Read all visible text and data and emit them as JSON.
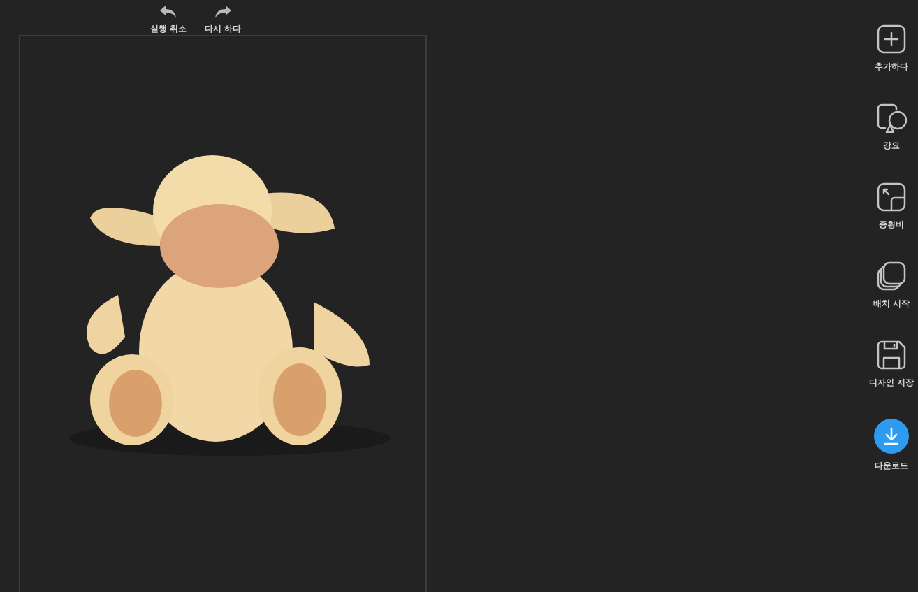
{
  "toolbar": [
    {
      "kind": "undo",
      "label": "실행 취소"
    },
    {
      "kind": "redo",
      "label": "다시 하다"
    }
  ],
  "sidebar": [
    {
      "kind": "add",
      "label": "추가하다"
    },
    {
      "kind": "shapes",
      "label": "강요"
    },
    {
      "kind": "ratio",
      "label": "종횡비"
    },
    {
      "kind": "batch",
      "label": "배치 시작"
    },
    {
      "kind": "save",
      "label": "디자인 저장"
    },
    {
      "kind": "download",
      "label": "다운로드"
    }
  ]
}
